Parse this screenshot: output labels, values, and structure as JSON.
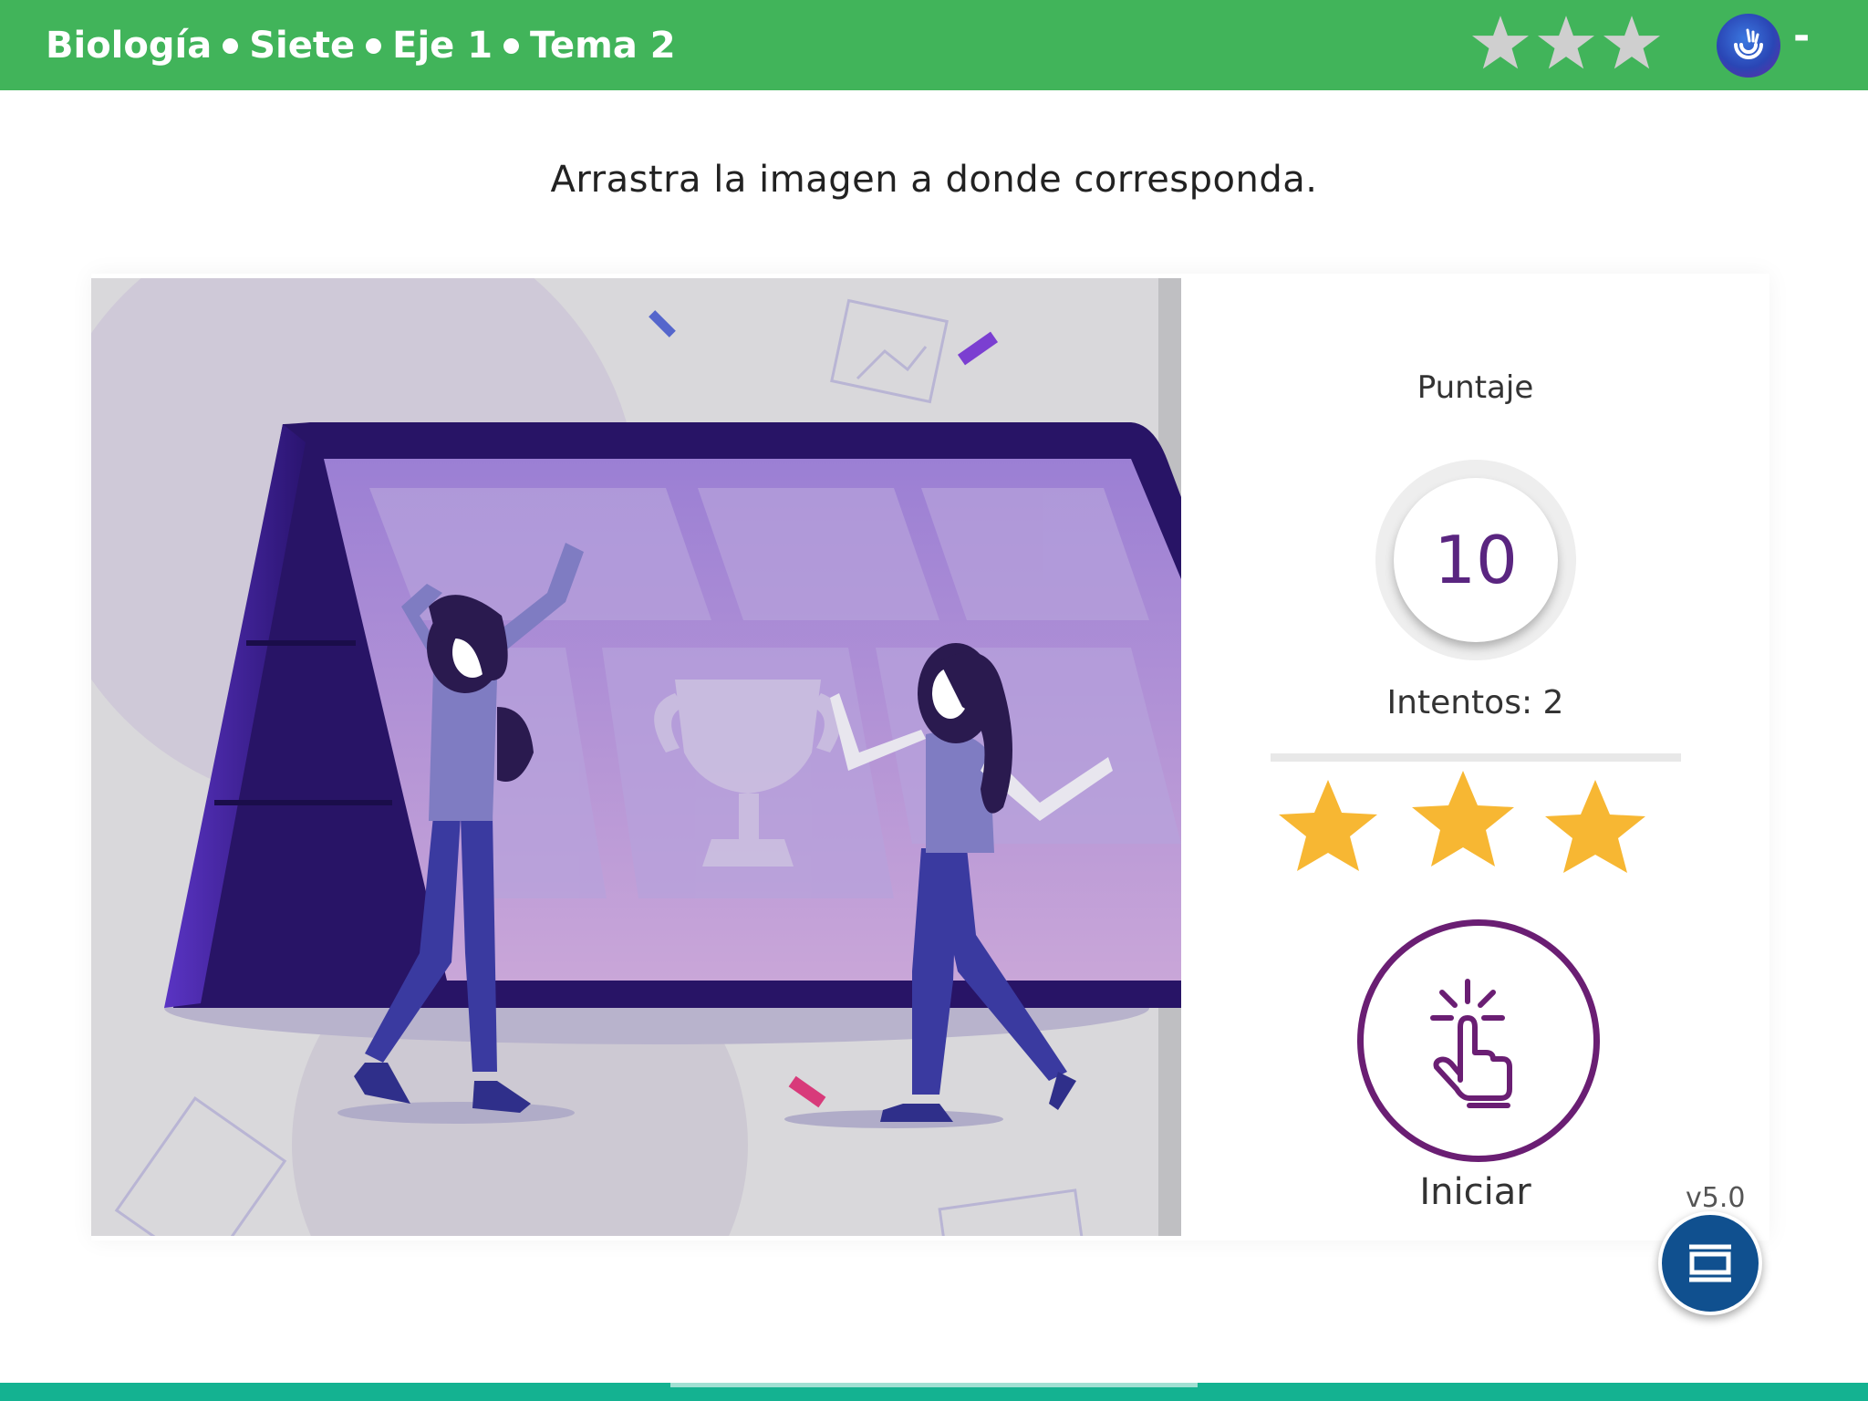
{
  "header": {
    "crumbs": [
      "Biología",
      "Siete",
      "Eje 1",
      "Tema 2"
    ],
    "stars_earned": 0,
    "stars_total": 3,
    "menu_label": "-",
    "logo_icon": "brand-logo-icon"
  },
  "activity": {
    "instruction": "Arrastra la imagen a donde corresponda.",
    "illustration_icon": "celebration-illustration"
  },
  "score": {
    "label": "Puntaje",
    "value": "10",
    "attempts_label": "Intentos:",
    "attempts_value": "2",
    "stars_earned": 3,
    "stars_total": 3,
    "star_color": "#f7b733"
  },
  "start": {
    "label": "Iniciar",
    "icon": "tap-hand-icon",
    "color": "#6a1e73"
  },
  "footer": {
    "version": "v5.0",
    "fab_icon": "slides-icon"
  },
  "colors": {
    "header_bg": "#41b45a",
    "bottom_bar": "#14b291",
    "score_text": "#5a2580",
    "fab_bg": "#10508f"
  }
}
